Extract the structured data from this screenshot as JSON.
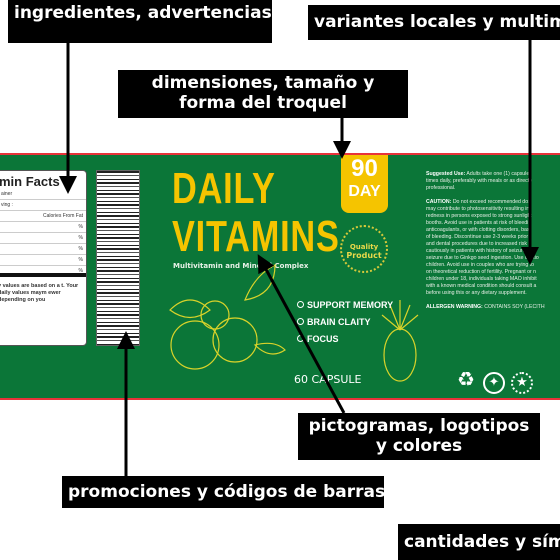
{
  "annotations": {
    "ingredients": "ingredientes, advertencias, direcciones",
    "variants": "variantes locales y multim",
    "dimensions": "dimensiones, tamaño y forma del troquel",
    "pictograms": "pictogramas, logotipos y colores",
    "promotions": "promociones y códigos de barras",
    "quantities": "cantidades y símb"
  },
  "label": {
    "colors": {
      "background": "#0b7638",
      "accent": "#f5c400",
      "border": "#e8333a"
    },
    "facts": {
      "title": "min Facts",
      "rows": [
        "ainer",
        "ving :",
        "Calories From Fat",
        "%",
        "%",
        "%",
        "%",
        "%"
      ],
      "footer": "y values are based on a t. Your daily values maym ewer depending on you"
    },
    "title_line1": "DAILY",
    "title_line2": "VITAMINS",
    "subtitle": "Multivitamin and Mineral Complex",
    "badge_num": "90",
    "badge_unit": "DAY",
    "seal_top": "Quality",
    "seal_main": "Product",
    "benefits": [
      "SUPPORT MEMORY",
      "BRAIN CLAITY",
      "FOCUS"
    ],
    "capsules": "60 CAPSULE",
    "suggested_head": "Suggested Use:",
    "suggested": [
      "Adults take one (1) capsule",
      "times daily, preferably with meals or as directe",
      "professional."
    ],
    "caution_head": "CAUTION:",
    "caution": [
      "Do not exceed recommended dos",
      "may contribute to photosensitivity resulting in",
      "redness in persons exposed to strong sunlight",
      "booths. Avoid use in patients at risk of bleedin",
      "anticoagulants, or with clotting disorders, bas",
      "of bleeding. Discontinue use 2-3 weeks prior t",
      "and dental procedures due to increased risk o",
      "cautiously in patients with history of seizure, bas",
      "seizure due to Ginkgo seed ingestion. Use cautio",
      "children. Avoid use in couples who are trying to",
      "on theoretical reduction of fertility. Pregnant or n",
      "children under 18, individuals taking MAO inhibit",
      "with a known medical condition should consult a",
      "before using this or any dietary supplement."
    ],
    "allergen_head": "ALLERGEN WARNING:",
    "allergen": "CONTAINS SOY (LECITH",
    "icons": [
      "recycle-icon",
      "certified-seal-icon",
      "quality-product-seal-icon"
    ]
  }
}
